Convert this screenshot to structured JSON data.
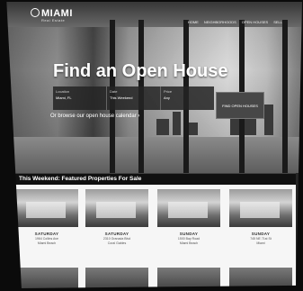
{
  "brand": {
    "logo_main": "MIAMI",
    "logo_sub": "Real Estate"
  },
  "nav": {
    "items": [
      "HOME",
      "NEIGHBORHOODS",
      "OPEN HOUSES",
      "SELL"
    ]
  },
  "hero": {
    "title": "Find an Open House",
    "search": {
      "fields": [
        {
          "label": "Location",
          "value": "Miami, FL"
        },
        {
          "label": "Date",
          "value": "This Weekend"
        },
        {
          "label": "Price",
          "value": "Any"
        }
      ],
      "button_label": "FIND OPEN HOUSES"
    },
    "link_text": "Or browse our open house calendar ›"
  },
  "featured": {
    "title": "This Weekend: Featured Properties For Sale",
    "cards": [
      {
        "name": "SATURDAY",
        "address": [
          "1964 Collins Ave",
          "Miami Beach"
        ]
      },
      {
        "name": "SATURDAY",
        "address": [
          "2310 Granada Blvd",
          "Coral Gables"
        ]
      },
      {
        "name": "SUNDAY",
        "address": [
          "1500 Bay Road",
          "Miami Beach"
        ]
      },
      {
        "name": "SUNDAY",
        "address": [
          "745 NE 71st St",
          "Miami"
        ]
      }
    ]
  }
}
